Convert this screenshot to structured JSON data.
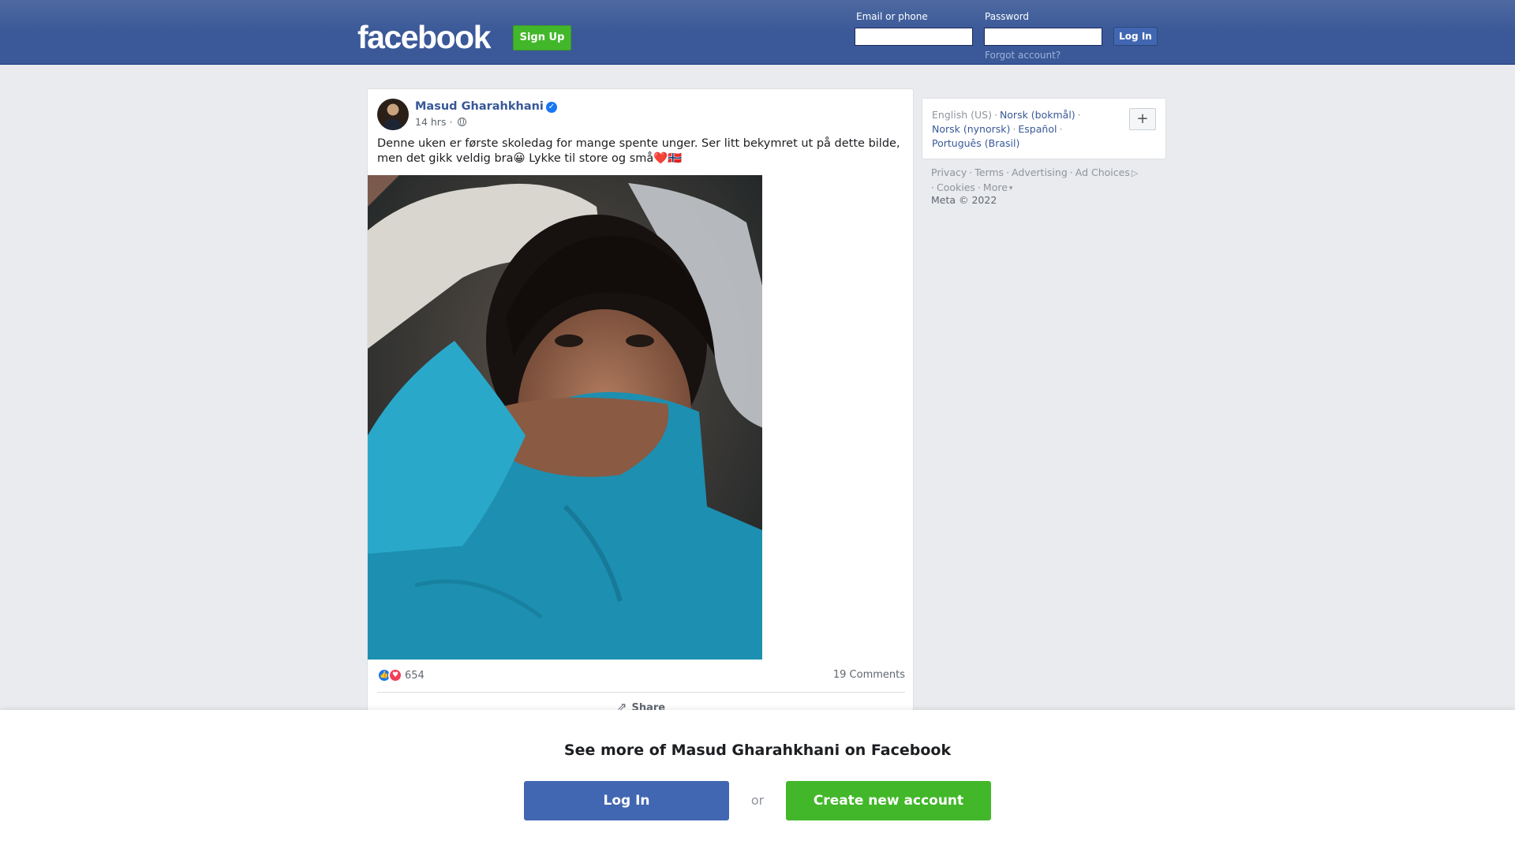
{
  "header": {
    "logo": "facebook",
    "signup_label": "Sign Up",
    "email_label": "Email or phone",
    "password_label": "Password",
    "login_label": "Log In",
    "forgot_label": "Forgot account?"
  },
  "post": {
    "author": "Masud Gharahkhani",
    "time": "14 hrs",
    "text": "Denne uken er første skoledag for mange spente unger. Ser litt bekymret ut på dette bilde, men det gikk veldig bra😀 Lykke til store og små❤️🇳🇴",
    "reaction_count": "654",
    "comments": "19 Comments",
    "share_label": "Share",
    "photo_icon": "photo-of-child"
  },
  "sidebar": {
    "languages": [
      {
        "label": "English (US)",
        "current": true
      },
      {
        "label": "Norsk (bokmål)"
      },
      {
        "label": "Norsk (nynorsk)"
      },
      {
        "label": "Español"
      },
      {
        "label": "Português (Brasil)"
      }
    ],
    "plus_label": "+",
    "footer_links": [
      "Privacy",
      "Terms",
      "Advertising",
      "Ad Choices",
      "Cookies",
      "More"
    ],
    "copyright": "Meta © 2022"
  },
  "banner": {
    "title": "See more of Masud Gharahkhani on Facebook",
    "login_label": "Log In",
    "or_label": "or",
    "create_label": "Create new account"
  },
  "colors": {
    "brand_blue": "#3b5998",
    "button_blue": "#4267b2",
    "green": "#42b72a",
    "link": "#385898"
  }
}
